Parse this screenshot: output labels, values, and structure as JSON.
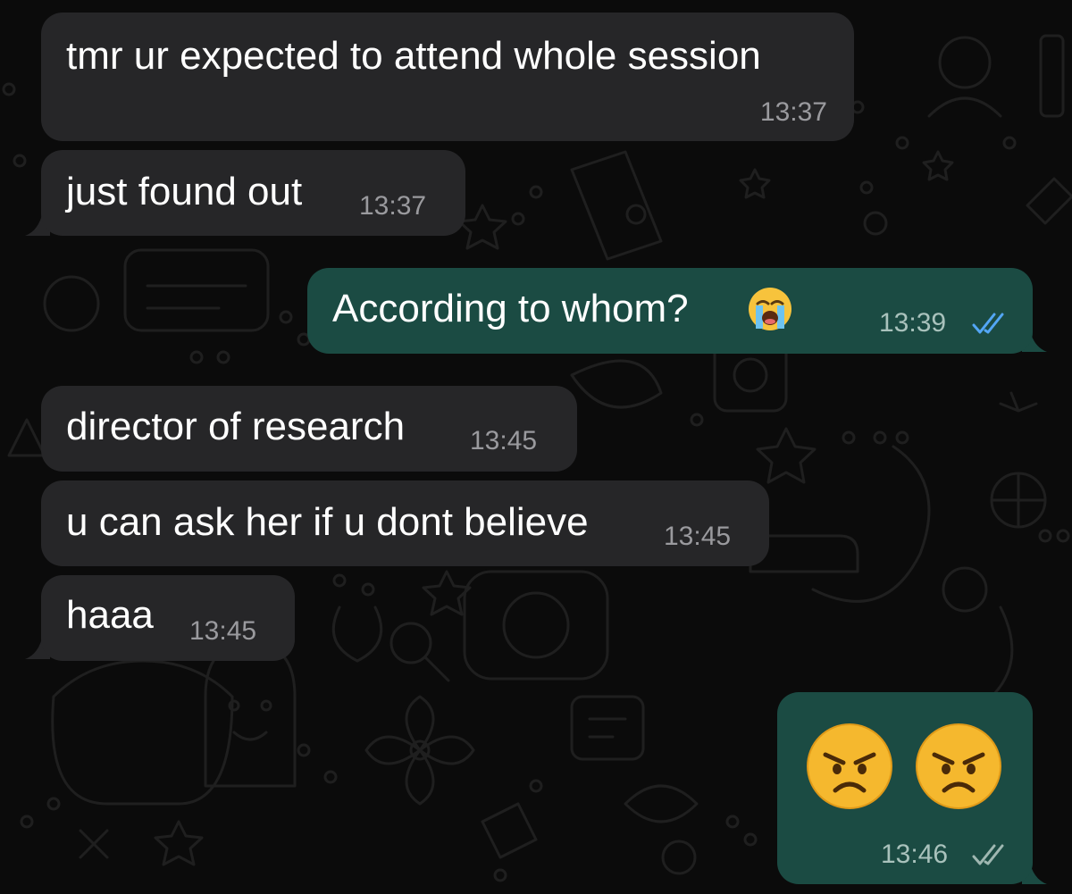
{
  "theme": {
    "incoming_bubble": "#262628",
    "outgoing_bubble": "#1b4b43",
    "background": "#0b0b0b",
    "read_tick_color": "#53a6f5",
    "delivered_tick_color": "#9fb7b1"
  },
  "messages": [
    {
      "direction": "incoming",
      "text": "tmr ur expected to attend whole session",
      "time": "13:37"
    },
    {
      "direction": "incoming",
      "text": "just found out",
      "time": "13:37"
    },
    {
      "direction": "outgoing",
      "text": "According to whom?",
      "emoji": "loudly-crying-face",
      "time": "13:39",
      "status": "read"
    },
    {
      "direction": "incoming",
      "text": "director of research",
      "time": "13:45"
    },
    {
      "direction": "incoming",
      "text": "u can ask her if u dont believe",
      "time": "13:45"
    },
    {
      "direction": "incoming",
      "text": "haaa",
      "time": "13:45"
    },
    {
      "direction": "outgoing",
      "emoji": "angry-face",
      "emoji_count": 2,
      "time": "13:46",
      "status": "delivered"
    }
  ]
}
